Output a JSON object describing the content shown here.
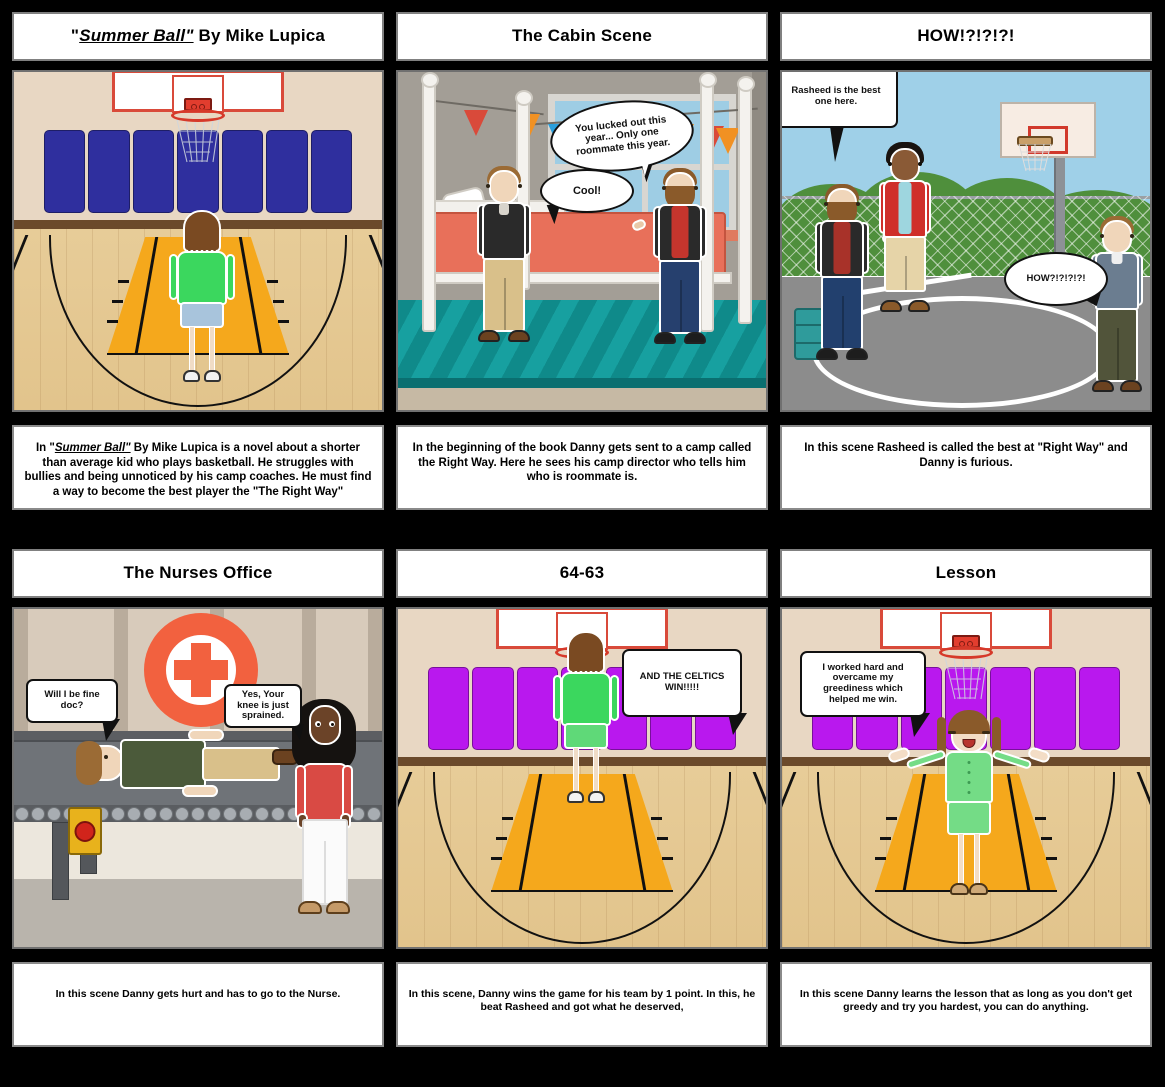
{
  "storyboard": {
    "panels": [
      {
        "id": "panel-1",
        "title_prefix": "\"",
        "title_italic": "Summer Ball\"",
        "title_suffix": " By Mike Lupica",
        "title_plain": "\"Summer Ball\" By Mike Lupica",
        "caption_pre": "In \"",
        "caption_italic": "Summer Ball\"",
        "caption_post": " By Mike Lupica is a novel about a shorter than average kid who plays basketball. He struggles with bullies and being unnoticed by his camp coaches. He must find a way to become the best player the \"The Right Way\"",
        "caption_plain": "In \"Summer Ball\" By Mike Lupica is a novel about a shorter than average kid who plays basketball. He struggles with bullies and being unnoticed by his camp coaches. He must find a way to become the best player the \"The Right Way\"",
        "scene": "indoor-gym-blue-pads",
        "bubbles": []
      },
      {
        "id": "panel-2",
        "title_plain": "The Cabin Scene",
        "caption_plain": "In the beginning of the book Danny gets sent to a camp called the Right Way. Here he sees his camp director who tells him who is roommate is.",
        "scene": "cabin-bunk-room",
        "bubbles": [
          {
            "name": "bubble-lucked-out",
            "text": "You lucked out this year... Only one roommate this year."
          },
          {
            "name": "bubble-cool",
            "text": "Cool!"
          }
        ]
      },
      {
        "id": "panel-3",
        "title_plain": "HOW!?!?!?!",
        "caption_plain": "In this scene Rasheed is called the best at \"Right Way\" and Danny is furious.",
        "scene": "outdoor-basketball-court",
        "bubbles": [
          {
            "name": "bubble-rasheed-best",
            "text": "Rasheed is the best one here."
          },
          {
            "name": "bubble-how",
            "text": "HOW?!?!?!?!"
          }
        ]
      },
      {
        "id": "panel-4",
        "title_plain": "The Nurses Office",
        "caption_plain": "In this scene Danny gets hurt and has to go to the Nurse.",
        "scene": "nurses-office",
        "bubbles": [
          {
            "name": "bubble-will-i-be-fine",
            "text": "Will I be fine doc?"
          },
          {
            "name": "bubble-knee-sprained",
            "text": "Yes, Your knee is just sprained."
          }
        ]
      },
      {
        "id": "panel-5",
        "title_plain": "64-63",
        "caption_plain": "In this scene, Danny wins the game for his team by 1 point. In this, he beat Rasheed and got what he deserved,",
        "scene": "indoor-gym-purple-pads",
        "bubbles": [
          {
            "name": "bubble-celtics-win",
            "text": "AND THE CELTICS WIN!!!!!"
          }
        ]
      },
      {
        "id": "panel-6",
        "title_plain": "Lesson",
        "caption_plain": "In this scene Danny learns the lesson that as long as you don't get greedy and try you hardest, you can do anything.",
        "scene": "indoor-gym-purple-pads-celebrate",
        "bubbles": [
          {
            "name": "bubble-worked-hard",
            "text": "I worked hard and overcame my greediness which helped me win."
          }
        ]
      }
    ]
  },
  "colors": {
    "background": "#000000",
    "panel_background": "#ffffff",
    "gym_wall": "#e8d7c3",
    "gym_floor": "#e7cc98",
    "key_paint": "#f5a81c",
    "pad_blue": "#2f2f9e",
    "pad_purple": "#b918ee",
    "rim_red": "#d6392a",
    "sky_blue": "#9fd0e8",
    "asphalt_gray": "#8c8c8c",
    "bush_green": "#4f8f3c",
    "cabin_wall": "#a39e96",
    "cabin_floor": "#17a0a0",
    "bed_orange": "#e8705a",
    "nurse_cross_orange": "#f2613f",
    "shirt_green": "#3bd75e",
    "shirt_red": "#cf3b35"
  }
}
